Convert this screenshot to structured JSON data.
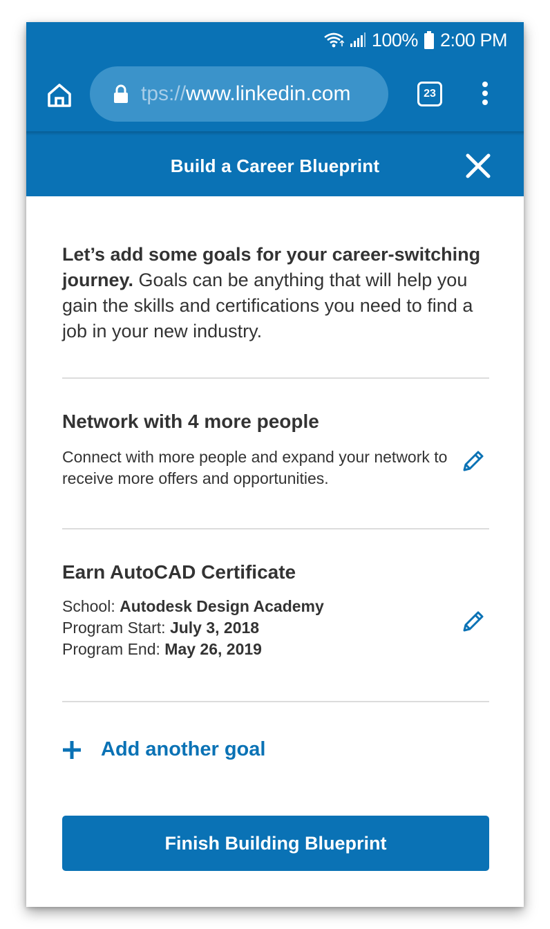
{
  "status_bar": {
    "battery_percent": "100%",
    "time": "2:00 PM"
  },
  "browser": {
    "url_scheme_fragment": "tps://",
    "url_domain": "www.linkedin.com",
    "tab_count": "23"
  },
  "header": {
    "title": "Build a Career Blueprint"
  },
  "intro": {
    "bold_text": "Let’s add some goals for your career-switching journey.",
    "text": " Goals can be anything that will help you gain the skills and certifications you need to find a job in your new industry."
  },
  "goals": [
    {
      "title": "Network with 4 more people",
      "description": "Connect with more people and expand your network to receive more offers and opportunities."
    },
    {
      "title": "Earn AutoCAD Certificate",
      "school_label": "School: ",
      "school_value": "Autodesk Design Academy",
      "start_label": "Program Start: ",
      "start_value": "July 3, 2018",
      "end_label": "Program End: ",
      "end_value": "May 26, 2019"
    }
  ],
  "add_goal_label": "Add another goal",
  "finish_button_label": "Finish Building Blueprint",
  "colors": {
    "brand_blue": "#0a72b5",
    "text_dark": "#333333",
    "divider": "#dcdcdc"
  },
  "icons": [
    "wifi-icon",
    "signal-icon",
    "battery-icon",
    "home-icon",
    "lock-icon",
    "tabs-icon",
    "more-vert-icon",
    "close-icon",
    "pencil-icon",
    "plus-icon"
  ]
}
